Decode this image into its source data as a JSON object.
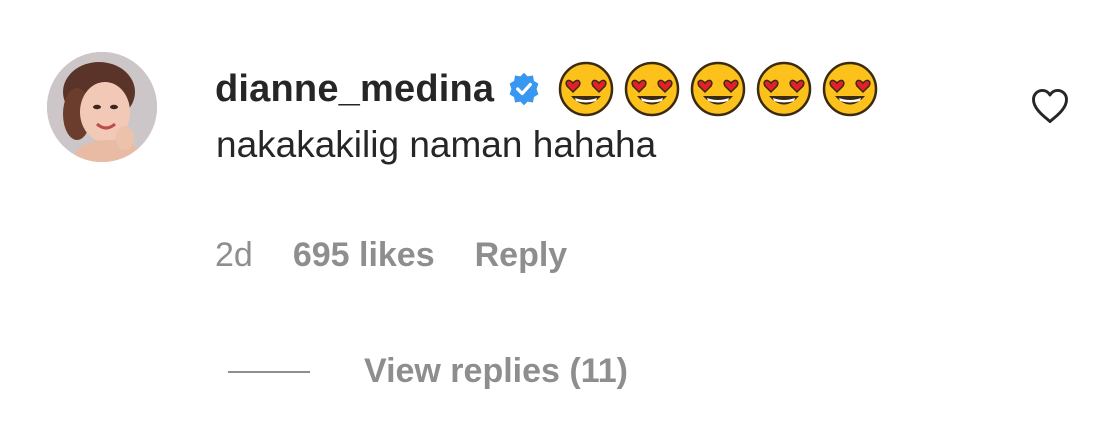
{
  "comment": {
    "username": "dianne_medina",
    "verified_icon": "verified-badge-icon",
    "emojis": [
      "smiling-face-with-heart-eyes",
      "smiling-face-with-heart-eyes",
      "smiling-face-with-heart-eyes",
      "smiling-face-with-heart-eyes",
      "smiling-face-with-heart-eyes"
    ],
    "text": "nakakakilig naman hahaha",
    "time": "2d",
    "likes": "695 likes",
    "reply_label": "Reply",
    "view_replies_label": "View replies (11)",
    "like_icon": "heart-outline-icon"
  },
  "colors": {
    "text_primary": "#262626",
    "text_secondary": "#8e8e8e",
    "verified_blue": "#3897f0",
    "emoji_yellow": "#fcc21b",
    "emoji_heart": "#e2202a"
  }
}
